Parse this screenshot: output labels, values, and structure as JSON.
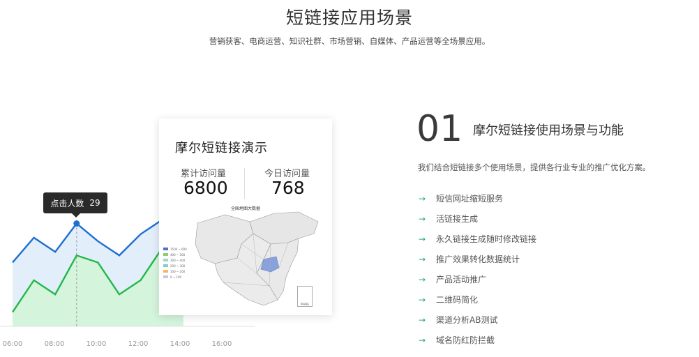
{
  "header": {
    "title": "短链接应用场景",
    "subtitle": "营销获客、电商运营、知识社群、市场营销、自媒体、产品运营等全场景应用。"
  },
  "chart": {
    "tooltip": {
      "label": "点击人数",
      "value": "29"
    },
    "colors": {
      "blue": "#1e6fd0",
      "green": "#22b849",
      "blue_fill": "#e3eefb",
      "green_fill": "#d4f4dc"
    }
  },
  "chart_data": {
    "type": "area",
    "x": [
      "06:00",
      "08:00",
      "10:00",
      "12:00",
      "14:00",
      "16:00"
    ],
    "series": [
      {
        "values": [
          18,
          25,
          21,
          29,
          24,
          20,
          26,
          30,
          22
        ]
      },
      {
        "values": [
          4,
          13,
          9,
          20,
          18,
          9,
          13,
          22,
          17
        ]
      }
    ],
    "ylim": [
      0,
      35
    ]
  },
  "demo": {
    "title": "摩尔短链接演示",
    "total_label": "累计访问量",
    "total_value": "6800",
    "today_label": "今日访问量",
    "today_value": "768",
    "map_title": "全国地图大数据",
    "legend": [
      {
        "label": "1500 ~ 600",
        "color": "#5470c6"
      },
      {
        "label": "400 ~ 500",
        "color": "#91cc75"
      },
      {
        "label": "300 ~ 400",
        "color": "#a0d9c0"
      },
      {
        "label": "200 ~ 300",
        "color": "#7fd0cc"
      },
      {
        "label": "100 ~ 200",
        "color": "#ffb45a"
      },
      {
        "label": "0 ~ 100",
        "color": "#c5c5e6"
      }
    ],
    "inset_label": "南海诸岛"
  },
  "feature": {
    "number": "01",
    "heading": "摩尔短链接使用场景与功能",
    "description": "我们结合短链接多个使用场景，提供各行业专业的推广优化方案。",
    "items": [
      "短信网址缩短服务",
      "活链接生成",
      "永久链接生成随时修改链接",
      "推广效果转化数据统计",
      "产品活动推广",
      "二维码简化",
      "渠道分析AB测试",
      "域名防红防拦截"
    ]
  }
}
